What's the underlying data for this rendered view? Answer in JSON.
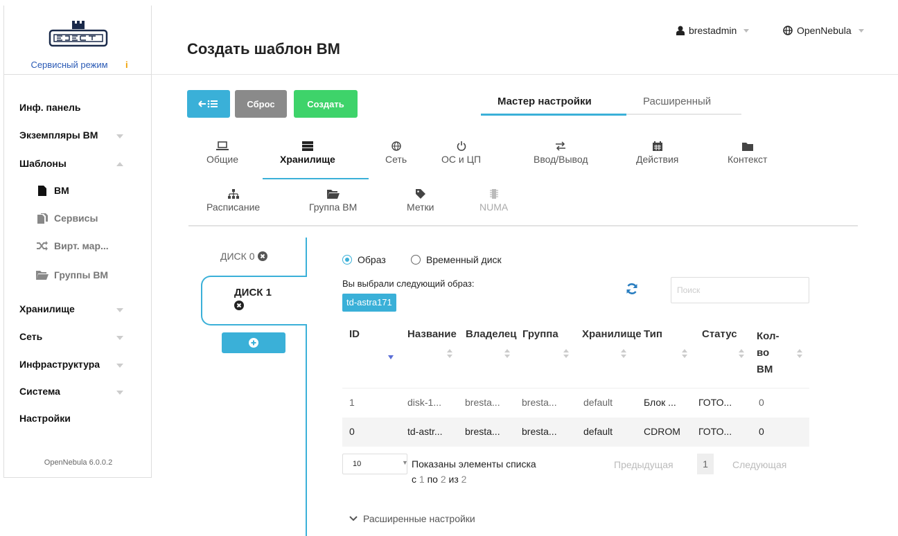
{
  "sidebar": {
    "mode_label": "Сервисный режим",
    "mode_info_icon": "i",
    "items": [
      {
        "label": "Инф. панель"
      },
      {
        "label": "Экземпляры ВМ"
      },
      {
        "label": "Шаблоны"
      },
      {
        "label": "ВМ"
      },
      {
        "label": "Сервисы"
      },
      {
        "label": "Вирт. мар..."
      },
      {
        "label": "Группы ВМ"
      },
      {
        "label": "Хранилище"
      },
      {
        "label": "Сеть"
      },
      {
        "label": "Инфраструктура"
      },
      {
        "label": "Система"
      },
      {
        "label": "Настройки"
      }
    ],
    "version": "OpenNebula 6.0.0.2"
  },
  "header": {
    "title": "Создать шаблон ВМ",
    "user": "brestadmin",
    "zone": "OpenNebula"
  },
  "toolbar": {
    "reset_label": "Сброс",
    "create_label": "Создать",
    "mode_wizard": "Мастер настройки",
    "mode_advanced": "Расширенный"
  },
  "sections": {
    "general": "Общие",
    "storage": "Хранилище",
    "network": "Сеть",
    "os_cpu": "ОС и ЦП",
    "io": "Ввод/Вывод",
    "actions": "Действия",
    "context": "Контекст",
    "schedule": "Расписание",
    "vm_group": "Группа ВМ",
    "tags": "Метки",
    "numa": "NUMA"
  },
  "disks": {
    "disk0": "ДИСК 0",
    "disk1": "ДИСК 1"
  },
  "disk_form": {
    "radio_image": "Образ",
    "radio_volatile": "Временный диск",
    "selected_label": "Вы выбрали следующий образ:",
    "selected_image": "td-astra171",
    "search_placeholder": "Поиск",
    "columns": [
      "ID",
      "Название",
      "Владелец",
      "Группа",
      "Хранилище",
      "Тип",
      "Статус",
      "Кол-во ВМ"
    ],
    "col_count_line1": "Кол-",
    "col_count_line2": "во",
    "col_count_line3": "ВМ",
    "rows": [
      {
        "id": "1",
        "name": "disk-1...",
        "owner": "bresta...",
        "group": "bresta...",
        "datastore": "default",
        "type": "Блок ...",
        "status": "ГОТО...",
        "vms": "0"
      },
      {
        "id": "0",
        "name": "td-astr...",
        "owner": "bresta...",
        "group": "bresta...",
        "datastore": "default",
        "type": "CDROM",
        "status": "ГОТО...",
        "vms": "0"
      }
    ],
    "page_size": "10",
    "page_info_text": "Показаны элементы списка",
    "page_info_from_word": "с",
    "page_info_from": "1",
    "page_info_to_word": "по",
    "page_info_to": "2",
    "page_info_of_word": "из",
    "page_info_total": "2",
    "prev": "Предыдущая",
    "current_page": "1",
    "next": "Следующая",
    "advanced": "Расширенные настройки"
  },
  "colors": {
    "accent": "#3ab0d8",
    "success": "#3ed36a",
    "neutral": "#8a8a8a"
  }
}
